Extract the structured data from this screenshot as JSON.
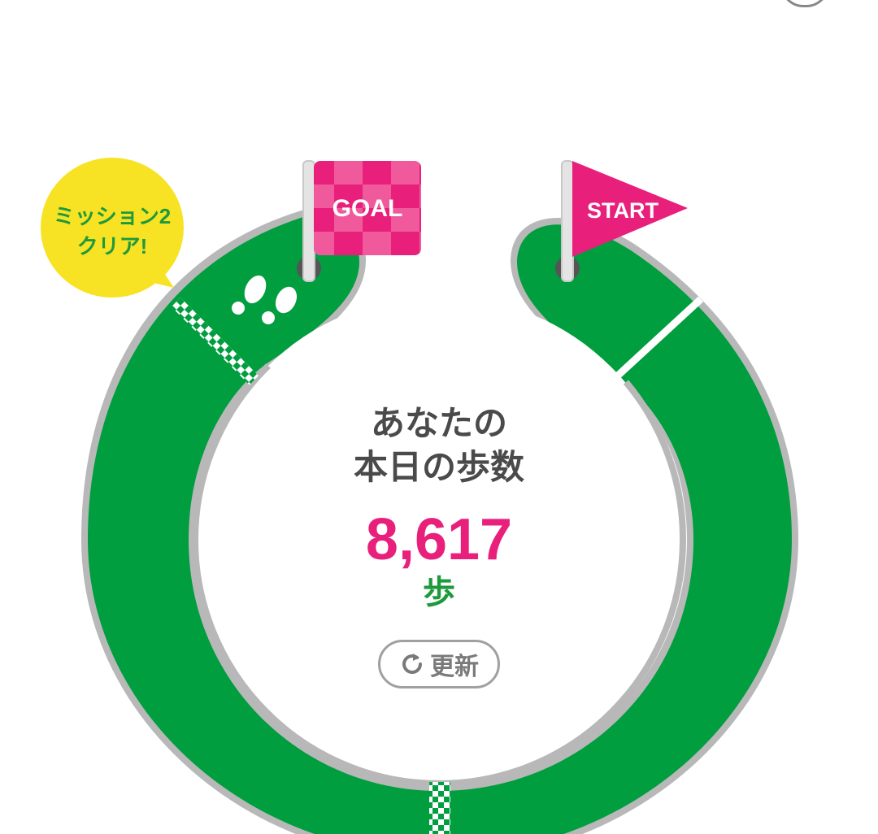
{
  "colors": {
    "track": "#009e3f",
    "track_border": "#b8b8b8",
    "accent_pink": "#e8207c",
    "bubble_yellow": "#f7e224",
    "bubble_text": "#1e9a3c",
    "text_dark": "#4a4a4a",
    "unit_green": "#1e9a3c"
  },
  "flags": {
    "goal": "GOAL",
    "start": "START"
  },
  "mission_bubble": {
    "line1": "ミッション2",
    "line2": "クリア!"
  },
  "summary": {
    "label_line1": "あなたの",
    "label_line2": "本日の歩数",
    "steps": "8,617",
    "unit": "歩"
  },
  "refresh": {
    "label": "更新",
    "icon": "refresh-icon"
  },
  "icons": [
    "footprints-icon",
    "goal-flag-icon",
    "start-flag-icon",
    "checkered-line-icon"
  ]
}
